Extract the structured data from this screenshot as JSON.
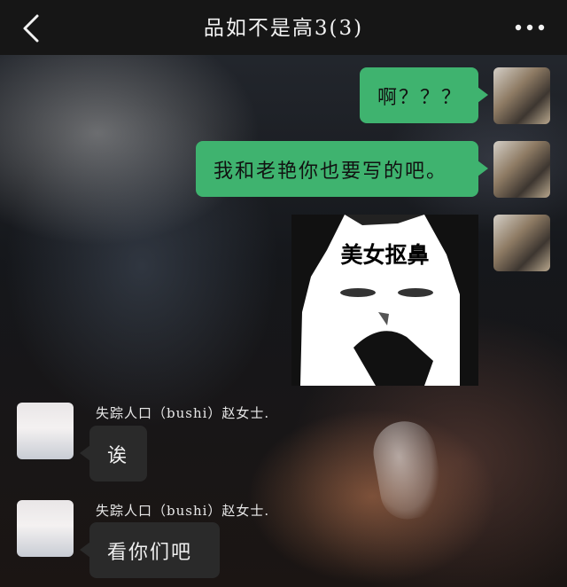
{
  "header": {
    "title": "品如不是高3(3)",
    "back_icon": "chevron-left-icon",
    "more_icon": "more-dots-icon"
  },
  "messages": [
    {
      "from": "me",
      "text": "啊？？？"
    },
    {
      "from": "me",
      "text": "我和老艳你也要写的吧。"
    },
    {
      "from": "me",
      "type": "sticker",
      "caption": "美女抠鼻"
    },
    {
      "from": "other",
      "sender": "失踪人口（bushi）赵女士.",
      "text": "诶"
    },
    {
      "from": "other",
      "sender": "失踪人口（bushi）赵女士.",
      "text": "看你们吧"
    }
  ]
}
